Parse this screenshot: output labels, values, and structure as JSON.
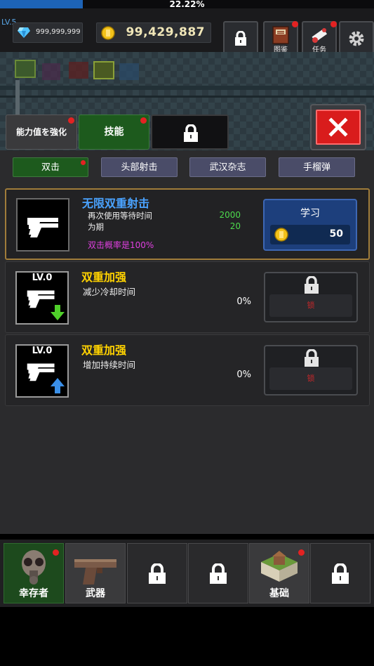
{
  "status": {
    "level": "LV.5",
    "xp_percent_text": "22.22%",
    "xp_fraction": 0.2222
  },
  "currency": {
    "gems": "999,999,999",
    "gold": "99,429,887"
  },
  "header_buttons": [
    {
      "icon": "lock-icon",
      "label": ""
    },
    {
      "icon": "book-icon",
      "label": "图鉴"
    },
    {
      "icon": "scroll-icon",
      "label": "任务"
    },
    {
      "icon": "gear-icon",
      "label": ""
    }
  ],
  "tabs": {
    "upgrade_stats": "能力值を強化",
    "skills": "技能",
    "locked": ""
  },
  "subtabs": [
    "双击",
    "头部射击",
    "武汉杂志",
    "手榴弹"
  ],
  "skills": [
    {
      "title": "无限双重射击",
      "line1": "再次使用等待时间",
      "line2": "为期",
      "value1": "2000",
      "value2": "20",
      "note": "双击概率是100%",
      "button_label": "学习",
      "cost": "50"
    },
    {
      "level": "LV.0",
      "title": "双重加强",
      "desc": "减少冷却时间",
      "percent": "0%",
      "lock_label": "锁"
    },
    {
      "level": "LV.0",
      "title": "双重加强",
      "desc": "增加持续时间",
      "percent": "0%",
      "lock_label": "锁"
    }
  ],
  "bottom_nav": [
    {
      "label": "幸存者",
      "icon": "gasmask-icon"
    },
    {
      "label": "武器",
      "icon": "pistol-icon"
    },
    {
      "label": "",
      "icon": "lock-icon"
    },
    {
      "label": "",
      "icon": "lock-icon"
    },
    {
      "label": "基础",
      "icon": "house-icon"
    },
    {
      "label": "",
      "icon": "lock-icon"
    }
  ],
  "colors": {
    "accent_green": "#1d5a1d",
    "skill_title_blue": "#4aa3ff",
    "skill_title_yellow": "#ffd200",
    "note_magenta": "#e040e0",
    "value_green": "#4ddb4d",
    "close_red": "#d91c1c"
  }
}
